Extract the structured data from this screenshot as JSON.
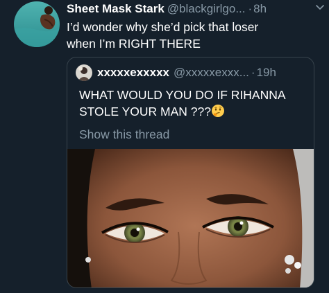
{
  "tweet": {
    "display_name": "Sheet Mask Stark",
    "handle": "@blackgirlgo...",
    "separator": "·",
    "time": "8h",
    "text_line1": "I’d wonder why she’d pick that loser",
    "text_line2": "when I’m RIGHT THERE",
    "avatar_icon": "profile-photo-swimmer",
    "menu_icon": "chevron-down-icon"
  },
  "quoted_tweet": {
    "display_name": "xxxxxexxxxx",
    "handle": "@xxxxxexxx...",
    "separator": "·",
    "time": "19h",
    "text_line1": "WHAT WOULD YOU DO IF RIHANNA",
    "text_line2": "STOLE YOUR MAN ???",
    "emoji": "thinking-face-emoji",
    "show_thread": "Show this thread",
    "image": "close-up-face-photo"
  },
  "colors": {
    "background": "#15202b",
    "text": "#ffffff",
    "secondary_text": "#8899a6",
    "border": "#38444d"
  }
}
